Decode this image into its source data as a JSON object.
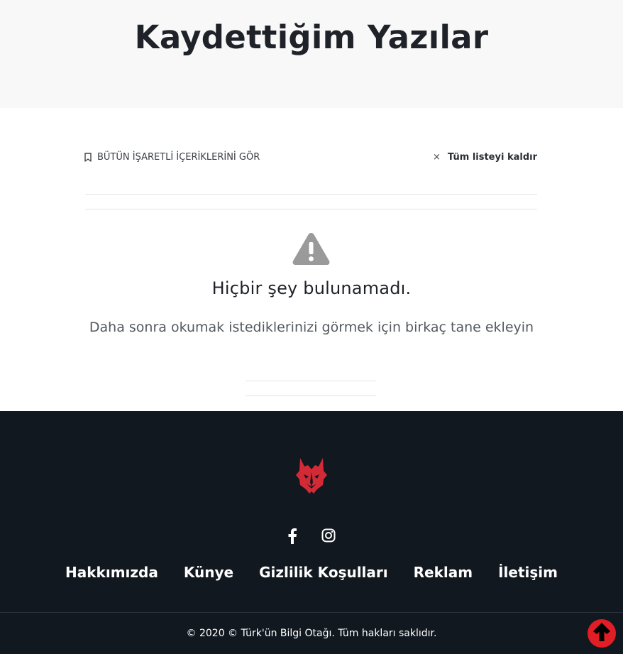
{
  "page": {
    "title": "Kaydettiğim Yazılar"
  },
  "toolbar": {
    "see_all_label": "BÜTÜN İŞARETLİ İÇERİKLERİNİ GÖR",
    "see_all_icon": "bookmark-icon",
    "remove_all_label": "Tüm listeyi kaldır",
    "remove_all_icon": "close-icon"
  },
  "empty_state": {
    "icon": "warning-icon",
    "title": "Hiçbir şey bulunamadı.",
    "subtitle": "Daha sonra okumak istediklerinizi görmek için birkaç tane ekleyin"
  },
  "footer": {
    "logo": "wolf-head-logo",
    "social": [
      {
        "name": "facebook-icon"
      },
      {
        "name": "instagram-icon"
      }
    ],
    "nav": [
      "Hakkımızda",
      "Künye",
      "Gizlilik Koşulları",
      "Reklam",
      "İletişim"
    ],
    "copyright": "© 2020 © Türk'ün Bilgi Otağı. Tüm hakları saklıdır."
  },
  "scroll_top_icon": "arrow-up-icon",
  "colors": {
    "hero_bg": "#f8f8f8",
    "footer_bg": "#121820",
    "accent_red": "#e11d25",
    "logo_red": "#d42a36",
    "icon_gray": "#9a9a9a"
  }
}
